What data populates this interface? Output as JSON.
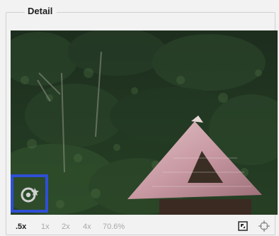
{
  "panel": {
    "title": "Detail"
  },
  "viewport": {
    "image_description_icon": "forest-hut-preview"
  },
  "clipping_toggle": {
    "icon": "clipping-warning-icon",
    "highlight_color": "#2f4fd6"
  },
  "zoom": {
    "options": [
      ".5x",
      "1x",
      "2x",
      "4x"
    ],
    "selected": ".5x",
    "readout": "70.6%"
  },
  "tools": {
    "fit_icon": "fit-to-frame-icon",
    "target_icon": "crosshair-target-icon"
  }
}
